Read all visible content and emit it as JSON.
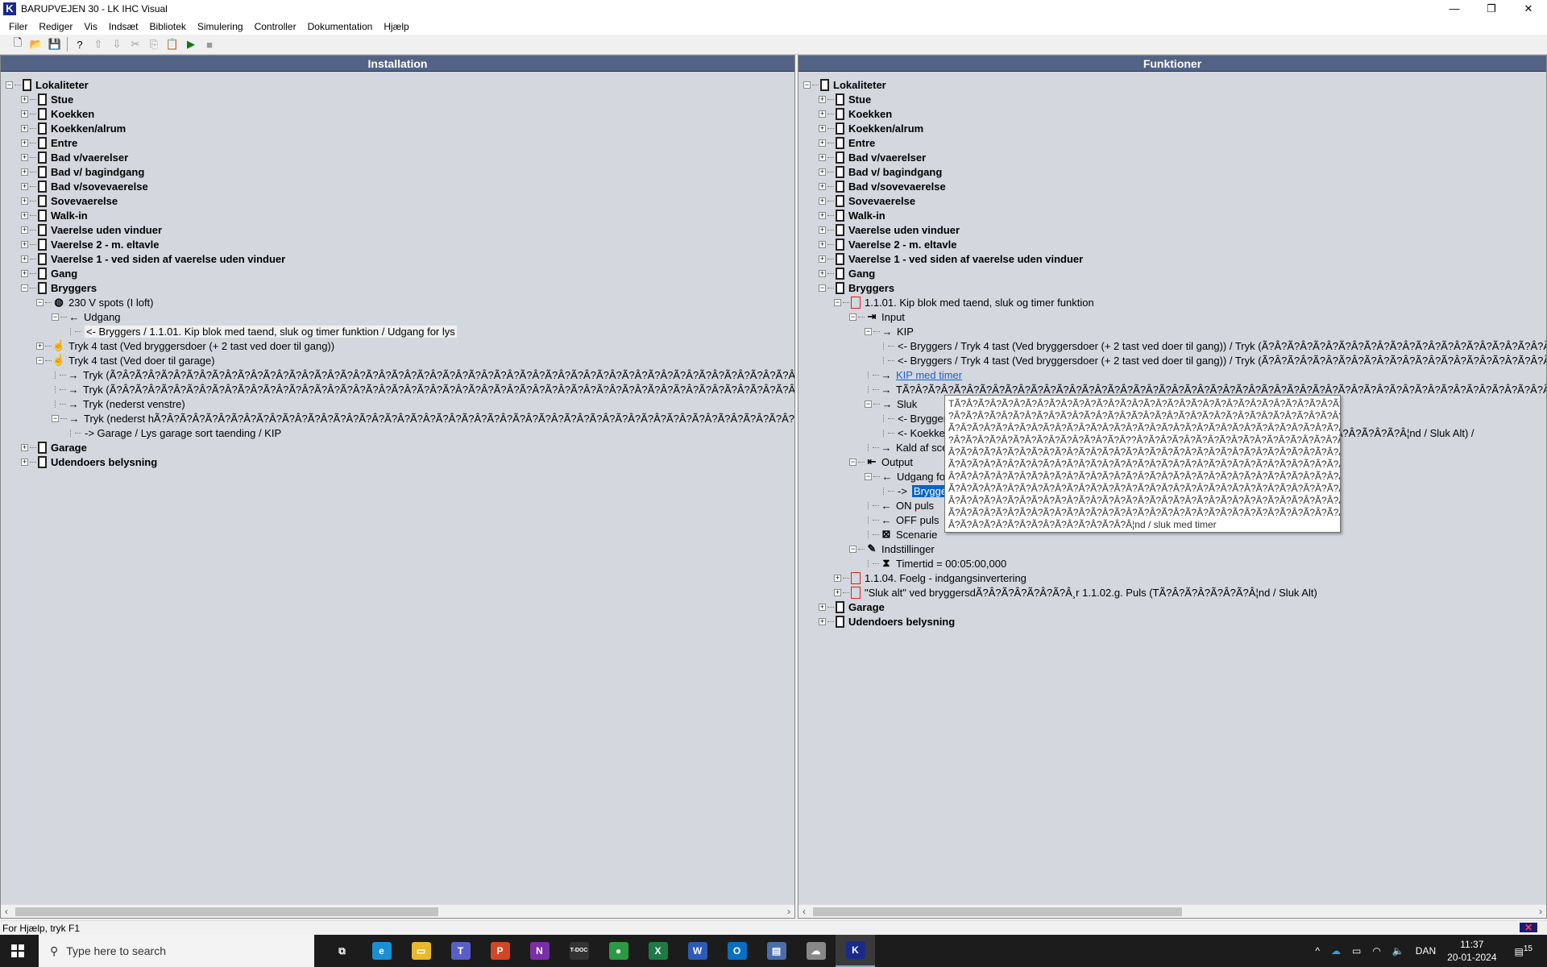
{
  "window": {
    "title": "BARUPVEJEN 30 - LK IHC Visual",
    "logo": "K",
    "minimize": "—",
    "maximize": "❐",
    "close": "✕"
  },
  "menu": [
    "Filer",
    "Rediger",
    "Vis",
    "Indsæt",
    "Bibliotek",
    "Simulering",
    "Controller",
    "Dokumentation",
    "Hjælp"
  ],
  "toolbar": [
    {
      "name": "new-icon",
      "glyph": "🗋",
      "dis": false
    },
    {
      "name": "open-icon",
      "glyph": "📂",
      "dis": false
    },
    {
      "name": "save-icon",
      "glyph": "💾",
      "dis": false
    },
    {
      "sep": true
    },
    {
      "name": "help-icon",
      "glyph": "?",
      "dis": false
    },
    {
      "name": "upload-icon",
      "glyph": "⇧",
      "dis": true
    },
    {
      "name": "download-icon",
      "glyph": "⇩",
      "dis": true
    },
    {
      "name": "cut-icon",
      "glyph": "✂",
      "dis": true
    },
    {
      "name": "copy-icon",
      "glyph": "⎘",
      "dis": true
    },
    {
      "name": "paste-icon",
      "glyph": "📋",
      "dis": true
    },
    {
      "name": "run-icon",
      "glyph": "▶",
      "dis": false,
      "color": "#0a7a0a"
    },
    {
      "name": "stop-icon",
      "glyph": "■",
      "dis": true
    }
  ],
  "left": {
    "title": "Installation",
    "rows": [
      {
        "l": 0,
        "t": "-",
        "i": "room",
        "x": "Lokaliteter",
        "s": "bold"
      },
      {
        "l": 1,
        "t": "+",
        "i": "room",
        "x": "Stue",
        "s": "bold"
      },
      {
        "l": 1,
        "t": "+",
        "i": "room",
        "x": "Koekken",
        "s": "bold"
      },
      {
        "l": 1,
        "t": "+",
        "i": "room",
        "x": "Koekken/alrum",
        "s": "bold"
      },
      {
        "l": 1,
        "t": "+",
        "i": "room",
        "x": "Entre",
        "s": "bold"
      },
      {
        "l": 1,
        "t": "+",
        "i": "room",
        "x": "Bad v/vaerelser",
        "s": "bold"
      },
      {
        "l": 1,
        "t": "+",
        "i": "room",
        "x": "Bad v/ bagindgang",
        "s": "bold"
      },
      {
        "l": 1,
        "t": "+",
        "i": "room",
        "x": "Bad v/sovevaerelse",
        "s": "bold"
      },
      {
        "l": 1,
        "t": "+",
        "i": "room",
        "x": "Sovevaerelse",
        "s": "bold"
      },
      {
        "l": 1,
        "t": "+",
        "i": "room",
        "x": "Walk-in",
        "s": "bold"
      },
      {
        "l": 1,
        "t": "+",
        "i": "room",
        "x": "Vaerelse uden vinduer",
        "s": "bold"
      },
      {
        "l": 1,
        "t": "+",
        "i": "room",
        "x": "Vaerelse 2 - m. eltavle",
        "s": "bold"
      },
      {
        "l": 1,
        "t": "+",
        "i": "room",
        "x": "Vaerelse 1 - ved siden af vaerelse uden vinduer",
        "s": "bold"
      },
      {
        "l": 1,
        "t": "+",
        "i": "room",
        "x": "Gang",
        "s": "bold"
      },
      {
        "l": 1,
        "t": "-",
        "i": "room",
        "x": "Bryggers",
        "s": "bold"
      },
      {
        "l": 2,
        "t": "-",
        "i": "speaker",
        "x": "230 V spots (I loft)"
      },
      {
        "l": 3,
        "t": "-",
        "i": "out",
        "x": "Udgang"
      },
      {
        "l": 4,
        "t": "",
        "i": "none",
        "x": "<-  Bryggers / 1.1.01. Kip blok med taend, sluk og timer funktion / Udgang for lys",
        "s": "hl"
      },
      {
        "l": 2,
        "t": "+",
        "i": "hand",
        "x": "Tryk 4 tast (Ved bryggersdoer (+ 2 tast ved doer til gang))"
      },
      {
        "l": 2,
        "t": "-",
        "i": "hand",
        "x": "Tryk 4 tast (Ved doer til garage)"
      },
      {
        "l": 3,
        "t": "",
        "i": "in",
        "x": "Tryk (Ã?Â?Ã?Â?Ã?Â?Ã?Â?Ã?Â?Ã?Â?Ã?Â?Ã?Â?Ã?Â?Ã?Â?Ã?Â?Ã?Â?Ã?Â?Ã?Â?Ã?Â?Ã?Â?Ã?Â?Ã?Â?Ã?Â?Ã?Â?Ã?Â?Ã?Â?Ã?Â?Ã?Â?Ã?Â?Ã?Â?Ã?Â?Ã?Â?Ã?Â?Ã?Â?"
      },
      {
        "l": 3,
        "t": "",
        "i": "in",
        "x": "Tryk (Ã?Â?Ã?Â?Ã?Â?Ã?Â?Ã?Â?Ã?Â?Ã?Â?Ã?Â?Ã?Â?Ã?Â?Ã?Â?Ã?Â?Ã?Â?Ã?Â?Ã?Â?Ã?Â?Ã?Â?Ã?Â?Ã?Â?Ã?Â?Ã?Â?Ã?Â?Ã?Â?Ã?Â?Ã?Â?Ã?Â?Ã?Â?Ã?Â?Ã?Â?Ã?Â?"
      },
      {
        "l": 3,
        "t": "",
        "i": "in",
        "x": "Tryk (nederst venstre)"
      },
      {
        "l": 3,
        "t": "-",
        "i": "in",
        "x": "Tryk (nederst hÃ?Â?Ã?Â?Ã?Â?Ã?Â?Ã?Â?Ã?Â?Ã?Â?Ã?Â?Ã?Â?Ã?Â?Ã?Â?Ã?Â?Ã?Â?Ã?Â?Ã?Â?Ã?Â?Ã?Â?Ã?Â?Ã?Â?Ã?Â?Ã?Â?Ã?Â?Ã?Â?Ã?Â?Ã?Â?Ã?Â?Ã?Â?Ã?Â?Ã?Â?Ã?Â?"
      },
      {
        "l": 4,
        "t": "",
        "i": "none",
        "x": "->  Garage / Lys garage sort taending / KIP"
      },
      {
        "l": 1,
        "t": "+",
        "i": "room",
        "x": "Garage",
        "s": "bold"
      },
      {
        "l": 1,
        "t": "+",
        "i": "room",
        "x": "Udendoers belysning",
        "s": "bold"
      }
    ]
  },
  "right": {
    "title": "Funktioner",
    "rows": [
      {
        "l": 0,
        "t": "-",
        "i": "room",
        "x": "Lokaliteter",
        "s": "bold"
      },
      {
        "l": 1,
        "t": "+",
        "i": "room",
        "x": "Stue",
        "s": "bold"
      },
      {
        "l": 1,
        "t": "+",
        "i": "room",
        "x": "Koekken",
        "s": "bold"
      },
      {
        "l": 1,
        "t": "+",
        "i": "room",
        "x": "Koekken/alrum",
        "s": "bold"
      },
      {
        "l": 1,
        "t": "+",
        "i": "room",
        "x": "Entre",
        "s": "bold"
      },
      {
        "l": 1,
        "t": "+",
        "i": "room",
        "x": "Bad v/vaerelser",
        "s": "bold"
      },
      {
        "l": 1,
        "t": "+",
        "i": "room",
        "x": "Bad v/ bagindgang",
        "s": "bold"
      },
      {
        "l": 1,
        "t": "+",
        "i": "room",
        "x": "Bad v/sovevaerelse",
        "s": "bold"
      },
      {
        "l": 1,
        "t": "+",
        "i": "room",
        "x": "Sovevaerelse",
        "s": "bold"
      },
      {
        "l": 1,
        "t": "+",
        "i": "room",
        "x": "Walk-in",
        "s": "bold"
      },
      {
        "l": 1,
        "t": "+",
        "i": "room",
        "x": "Vaerelse uden vinduer",
        "s": "bold"
      },
      {
        "l": 1,
        "t": "+",
        "i": "room",
        "x": "Vaerelse 2 - m. eltavle",
        "s": "bold"
      },
      {
        "l": 1,
        "t": "+",
        "i": "room",
        "x": "Vaerelse 1 - ved siden af vaerelse uden vinduer",
        "s": "bold"
      },
      {
        "l": 1,
        "t": "+",
        "i": "room",
        "x": "Gang",
        "s": "bold"
      },
      {
        "l": 1,
        "t": "-",
        "i": "room",
        "x": "Bryggers",
        "s": "bold"
      },
      {
        "l": 2,
        "t": "-",
        "i": "func",
        "x": "1.1.01. Kip blok med taend, sluk og timer funktion"
      },
      {
        "l": 3,
        "t": "-",
        "i": "inbox",
        "x": "Input"
      },
      {
        "l": 4,
        "t": "-",
        "i": "in",
        "x": "KIP"
      },
      {
        "l": 5,
        "t": "",
        "i": "none",
        "x": "<-  Bryggers / Tryk 4 tast (Ved bryggersdoer (+ 2 tast ved doer til gang))  / Tryk (Ã?Â?Ã?Â?Ã?Â?Ã?Â?Ã?Â?Ã?Â?Ã?Â?Ã?Â?Ã?Â?Ã?Â?Ã?Â?Ã?Â?Ã?Â?Ã?Â?Ã?Â?"
      },
      {
        "l": 5,
        "t": "",
        "i": "none",
        "x": "<-  Bryggers / Tryk 4 tast (Ved bryggersdoer (+ 2 tast ved doer til gang))  / Tryk (Ã?Â?Ã?Â?Ã?Â?Ã?Â?Ã?Â?Ã?Â?Ã?Â?Ã?Â?Ã?Â?Ã?Â?Ã?Â?Ã?Â?Ã?Â?Ã?Â?Ã?Â?"
      },
      {
        "l": 4,
        "t": "",
        "i": "in",
        "x": "KIP med timer",
        "s": "link"
      },
      {
        "l": 4,
        "t": "",
        "i": "in",
        "x": "TÃ?Â?Ã?Â?Ã?Â?Ã?Â?Ã?Â?Ã?Â?Ã?Â?Ã?Â?Ã?Â?Ã?Â?Ã?Â?Ã?Â?Ã?Â?Ã?Â?Ã?Â?Ã?Â?Ã?Â?Ã?Â?Ã?Â?Ã?Â?Ã?Â?Ã?Â?Ã?Â?Ã?Â?Ã?Â?Ã?Â?Ã?Â?Ã?Â?Ã?Â?Ã?Â?"
      },
      {
        "l": 4,
        "t": "-",
        "i": "in",
        "x": "Sluk"
      },
      {
        "l": 5,
        "t": "",
        "i": "none",
        "x": "<-  Bryggers / Tryk 4 tast (Ved bryggersdoer (+ 2 tast ved doer til gang)) / Sluk alt) / Puls"
      },
      {
        "l": 5,
        "t": "",
        "i": "none",
        "x": "<-  Koekken / Tryk 4 tast (Ved doer til gang) / Tryk Ã?Â?Ã?Â?Ã?Â?Ã?Â? 1.1.02.g. Puls (TÃ?Â?Ã?Â?Ã?Â?Ã?Â¦nd / Sluk Alt) /"
      },
      {
        "l": 4,
        "t": "",
        "i": "in",
        "x": "Kald af scenarie"
      },
      {
        "l": 3,
        "t": "-",
        "i": "outbox",
        "x": "Output"
      },
      {
        "l": 4,
        "t": "-",
        "i": "out",
        "x": "Udgang for lys"
      },
      {
        "l": 5,
        "t": "",
        "i": "none",
        "x": "->",
        "sel": "Bryggers / 230 V spots (I loft) / Udgang"
      },
      {
        "l": 4,
        "t": "",
        "i": "out",
        "x": "ON puls"
      },
      {
        "l": 4,
        "t": "",
        "i": "out",
        "x": "OFF puls"
      },
      {
        "l": 4,
        "t": "",
        "i": "scene",
        "x": "Scenarie"
      },
      {
        "l": 3,
        "t": "-",
        "i": "pen",
        "x": "Indstillinger"
      },
      {
        "l": 4,
        "t": "",
        "i": "timer",
        "x": "Timertid = 00:05:00,000"
      },
      {
        "l": 2,
        "t": "+",
        "i": "func",
        "x": "1.1.04. Foelg - indgangsinvertering"
      },
      {
        "l": 2,
        "t": "+",
        "i": "func",
        "x": "\"Sluk alt\" ved bryggersdÃ?Â?Ã?Â?Ã?Â?Ã?Â¸r 1.1.02.g. Puls (TÃ?Â?Ã?Â?Ã?Â?Ã?Â¦nd / Sluk Alt)"
      },
      {
        "l": 1,
        "t": "+",
        "i": "room",
        "x": "Garage",
        "s": "bold"
      },
      {
        "l": 1,
        "t": "+",
        "i": "room",
        "x": "Udendoers belysning",
        "s": "bold"
      }
    ]
  },
  "tooltip": [
    "TÃ?Â?Ã?Â?Ã?Â?Ã?Â?Ã?Â?Ã?Â?Ã?Â?Ã?Â?Ã?Â?Ã?Â?Ã?Â?Ã?Â?Ã?Â?Ã?Â?Ã?Â?Ã?Â?Ã?Â?Ã?Â?Ã",
    "?Â?Ã?Â?Ã?Â?Ã?Â?Ã?Â?Ã?Â?Ã?Â?Ã?Â?Ã?Â?Ã?Â?Ã?Â?Ã?Â?Ã?Â?Ã?Â?Ã?Â?Ã?Â?Ã?Â?Ã?Â?Ã",
    "Ã?Â?Ã?Â?Ã?Â?Ã?Â?Ã?Â?Ã?Â?Ã?Â?Ã?Â?Ã?Â?Ã?Â?Ã?Â?Ã?Â?Ã?Â?Ã?Â?Ã?Â?Ã?Â?Ã?Â?Ã?Â?Ã",
    "?Â?Ã?Â?Ã?Â?Ã?Â?Ã?Â?Ã?Â?Ã?Â?Ã?Â??Â?Ã?Â?Ã?Â?Ã?Â?Ã?Â?Ã?Â?Ã?Â?Ã?Â?Ã?Â?Ã?Â?Ã?",
    "Â?Ã?Â?Ã?Â?Ã?Â?Ã?Â?Ã?Â?Ã?Â?Ã?Â?Ã?Â?Ã?Â?Ã?Â?Ã?Â?Ã?Â?Ã?Â?Ã?Â?Ã?Â?Ã?Â?Ã?Â?",
    "Ã?Â?Ã?Â?Ã?Â?Ã?Â?Ã?Â?Ã?Â?Ã?Â?Ã?Â?Ã?Â?Ã?Â?Ã?Â?Ã?Â?Ã?Â?Ã?Â?Ã?Â?Ã?Â?Ã?Â?Ã?Â?",
    "Â?Ã?Â?Ã?Â?Ã?Â?Ã?Â?Ã?Â?Ã?Â?Ã?Â?Ã?Â?Ã?Â?Ã?Â?Ã?Â?Ã?Â?Ã?Â?Ã?Â?Ã?Â?Ã?Â?Ã?Â?",
    "Ã?Â?Ã?Â?Ã?Â?Ã?Â?Ã?Â?Ã?Â?Ã?Â?Ã?Â?Ã?Â?Ã?Â?Ã?Â?Ã?Â?Ã?Â?Ã?Â?Ã?Â?Ã?Â?Ã?Â?Ã?",
    "Â?Ã?Â?Ã?Â?Ã?Â?Ã?Â?Ã?Â?Ã?Â?Ã?Â?Ã?Â?Ã?Â?Ã?Â?Ã?Â?Ã?Â?Ã?Â?Ã?Â?Ã?Â?Ã?Â?Ã?Â?",
    "Ã?Â?Ã?Â?Ã?Â?Ã?Â?Ã?Â?Ã?Â?Ã?Â?Ã?Â?Ã?Â?Ã?Â?Ã?Â?Ã?Â?Ã?Â?Ã?Â?Ã?Â?Ã?Â?Ã?Â?Ã?",
    "Â?Ã?Â?Ã?Â?Ã?Â?Ã?Â?Ã?Â?Ã?Â?Ã?Â?Â¦nd / sluk med timer"
  ],
  "status": {
    "text": "For Hjælp, tryk F1",
    "indicator": "✕"
  },
  "taskbar": {
    "search_placeholder": "Type here to search",
    "apps": [
      {
        "name": "task-view",
        "label": "⧉",
        "bg": "transparent"
      },
      {
        "name": "edge",
        "label": "e",
        "bg": "#1b8fd6"
      },
      {
        "name": "file-explorer",
        "label": "▭",
        "bg": "#e8b92a"
      },
      {
        "name": "teams",
        "label": "T",
        "bg": "#5a5fc8"
      },
      {
        "name": "powerpoint",
        "label": "P",
        "bg": "#d24726"
      },
      {
        "name": "onenote",
        "label": "N",
        "bg": "#7a2fa8"
      },
      {
        "name": "terminal",
        "label": "T-DOC",
        "bg": "#333"
      },
      {
        "name": "chrome",
        "label": "●",
        "bg": "#2b9a45"
      },
      {
        "name": "excel",
        "label": "X",
        "bg": "#1f7a45"
      },
      {
        "name": "word",
        "label": "W",
        "bg": "#2b5bb5"
      },
      {
        "name": "outlook",
        "label": "O",
        "bg": "#0a6fc2"
      },
      {
        "name": "remote-desktop",
        "label": "▤",
        "bg": "#4a6ea8"
      },
      {
        "name": "app-cloud",
        "label": "☁",
        "bg": "#888"
      },
      {
        "name": "lk-ihc-visual",
        "label": "K",
        "bg": "#1a2a8a",
        "active": true
      }
    ],
    "tray": {
      "chevron": "^",
      "language": "DAN",
      "time": "11:37",
      "date": "20-01-2024",
      "notifications": "15"
    }
  }
}
